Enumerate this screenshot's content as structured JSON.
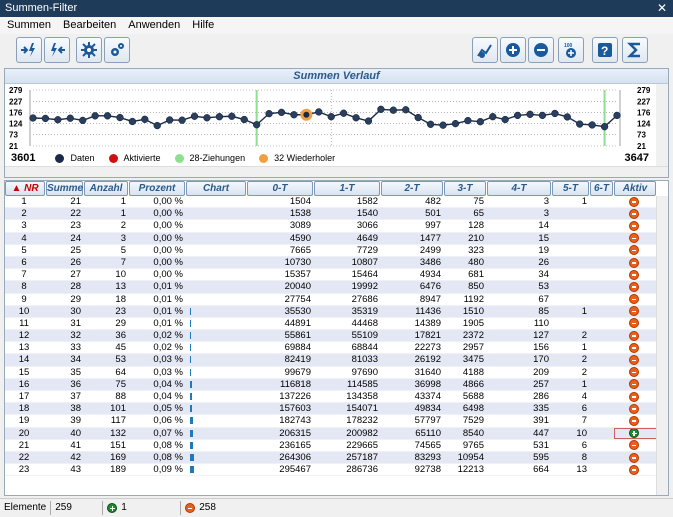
{
  "window": {
    "title": "Summen-Filter",
    "close": "✕"
  },
  "menu": [
    "Summen",
    "Bearbeiten",
    "Anwenden",
    "Hilfe"
  ],
  "panel": {
    "title": "Summen Verlauf",
    "yticks": [
      "279",
      "227",
      "176",
      "124",
      "73",
      "21"
    ],
    "start_label": "3601",
    "end_label": "3647",
    "legend": [
      {
        "label": "Daten",
        "color": "#1a2a4a"
      },
      {
        "label": "Aktivierte",
        "color": "#d01010"
      },
      {
        "label": "28-Ziehungen",
        "color": "#8ee08e"
      },
      {
        "label": "32 Wiederholer",
        "color": "#f0a040"
      }
    ]
  },
  "chart_data": {
    "type": "line",
    "x_range": [
      3601,
      3647
    ],
    "ylim": [
      21,
      279
    ],
    "y_ticks": [
      21,
      73,
      124,
      176,
      227,
      279
    ],
    "values": [
      150,
      148,
      142,
      149,
      139,
      160,
      160,
      152,
      134,
      144,
      115,
      141,
      140,
      158,
      151,
      156,
      158,
      143,
      119,
      170,
      176,
      165,
      165,
      178,
      156,
      172,
      151,
      136,
      190,
      186,
      188,
      152,
      121,
      117,
      124,
      138,
      133,
      156,
      143,
      162,
      167,
      162,
      171,
      155,
      122,
      118,
      110,
      162
    ],
    "highlight_index": 22,
    "green_markers": [
      18,
      46
    ]
  },
  "grid": {
    "headers": [
      {
        "label": "▲ NR",
        "active": true
      },
      {
        "label": "Summe"
      },
      {
        "label": "Anzahl"
      },
      {
        "label": "Prozent"
      },
      {
        "label": "Chart"
      },
      {
        "label": "0-T"
      },
      {
        "label": "1-T"
      },
      {
        "label": "2-T"
      },
      {
        "label": "3-T"
      },
      {
        "label": "4-T"
      },
      {
        "label": "5-T"
      },
      {
        "label": "6-T"
      },
      {
        "label": "Aktiv"
      }
    ],
    "rows": [
      [
        "1",
        "21",
        "1",
        "0,00 %",
        "",
        "1504",
        "1582",
        "482",
        "75",
        "3",
        "1",
        "",
        "-"
      ],
      [
        "2",
        "22",
        "1",
        "0,00 %",
        "",
        "1538",
        "1540",
        "501",
        "65",
        "3",
        "",
        "",
        "-"
      ],
      [
        "3",
        "23",
        "2",
        "0,00 %",
        "",
        "3089",
        "3066",
        "997",
        "128",
        "14",
        "",
        "",
        "-"
      ],
      [
        "4",
        "24",
        "3",
        "0,00 %",
        "",
        "4590",
        "4649",
        "1477",
        "210",
        "15",
        "",
        "",
        "-"
      ],
      [
        "5",
        "25",
        "5",
        "0,00 %",
        "",
        "7665",
        "7729",
        "2499",
        "323",
        "19",
        "",
        "",
        "-"
      ],
      [
        "6",
        "26",
        "7",
        "0,00 %",
        "",
        "10730",
        "10807",
        "3486",
        "480",
        "26",
        "",
        "",
        "-"
      ],
      [
        "7",
        "27",
        "10",
        "0,00 %",
        "",
        "15357",
        "15464",
        "4934",
        "681",
        "34",
        "",
        "",
        "-"
      ],
      [
        "8",
        "28",
        "13",
        "0,01 %",
        "",
        "20040",
        "19992",
        "6476",
        "850",
        "53",
        "",
        "",
        "-"
      ],
      [
        "9",
        "29",
        "18",
        "0,01 %",
        "",
        "27754",
        "27686",
        "8947",
        "1192",
        "67",
        "",
        "",
        "-"
      ],
      [
        "10",
        "30",
        "23",
        "0,01 %",
        "1",
        "35530",
        "35319",
        "11436",
        "1510",
        "85",
        "1",
        "",
        "-"
      ],
      [
        "11",
        "31",
        "29",
        "0,01 %",
        "1",
        "44891",
        "44468",
        "14389",
        "1905",
        "110",
        "",
        "",
        "-"
      ],
      [
        "12",
        "32",
        "36",
        "0,02 %",
        "1",
        "55861",
        "55109",
        "17821",
        "2372",
        "127",
        "2",
        "",
        "-"
      ],
      [
        "13",
        "33",
        "45",
        "0,02 %",
        "1",
        "69884",
        "68844",
        "22273",
        "2957",
        "156",
        "1",
        "",
        "-"
      ],
      [
        "14",
        "34",
        "53",
        "0,03 %",
        "1",
        "82419",
        "81033",
        "26192",
        "3475",
        "170",
        "2",
        "",
        "-"
      ],
      [
        "15",
        "35",
        "64",
        "0,03 %",
        "1",
        "99679",
        "97690",
        "31640",
        "4188",
        "209",
        "2",
        "",
        "-"
      ],
      [
        "16",
        "36",
        "75",
        "0,04 %",
        "2",
        "116818",
        "114585",
        "36998",
        "4866",
        "257",
        "1",
        "",
        "-"
      ],
      [
        "17",
        "37",
        "88",
        "0,04 %",
        "2",
        "137226",
        "134358",
        "43374",
        "5688",
        "286",
        "4",
        "",
        "-"
      ],
      [
        "18",
        "38",
        "101",
        "0,05 %",
        "2",
        "157603",
        "154071",
        "49834",
        "6498",
        "335",
        "6",
        "",
        "-"
      ],
      [
        "19",
        "39",
        "117",
        "0,06 %",
        "3",
        "182743",
        "178232",
        "57797",
        "7529",
        "391",
        "7",
        "",
        "-"
      ],
      [
        "20",
        "40",
        "132",
        "0,07 %",
        "3",
        "206315",
        "200982",
        "65110",
        "8540",
        "447",
        "10",
        "",
        "+"
      ],
      [
        "21",
        "41",
        "151",
        "0,08 %",
        "3",
        "236165",
        "229665",
        "74565",
        "9765",
        "531",
        "6",
        "",
        "-"
      ],
      [
        "22",
        "42",
        "169",
        "0,08 %",
        "4",
        "264306",
        "257187",
        "83293",
        "10954",
        "595",
        "8",
        "",
        "-"
      ],
      [
        "23",
        "43",
        "189",
        "0,09 %",
        "4",
        "295467",
        "286736",
        "92738",
        "12213",
        "664",
        "13",
        "",
        "-"
      ]
    ]
  },
  "status": {
    "label": "Elemente",
    "count": "259",
    "active_count": "1",
    "inactive_count": "258"
  }
}
